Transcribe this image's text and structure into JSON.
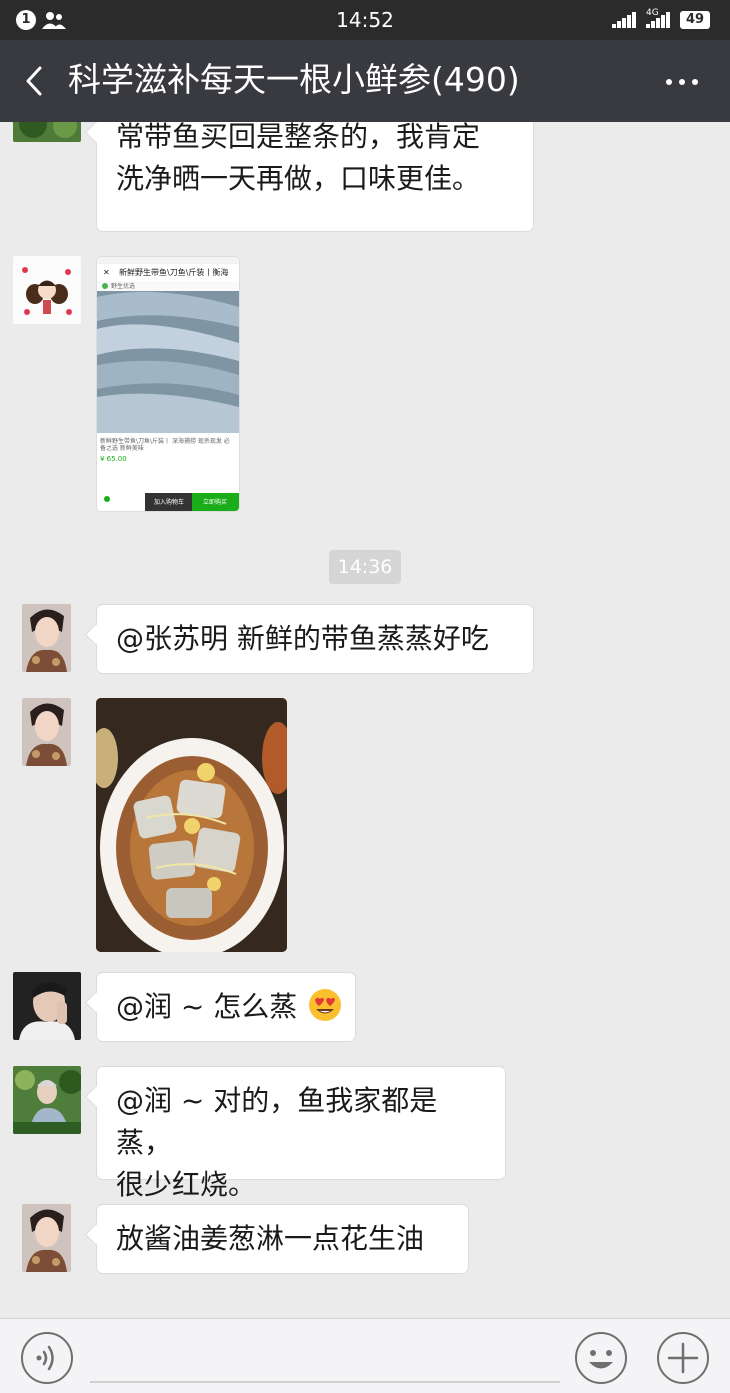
{
  "status_bar": {
    "badge": "1",
    "time": "14:52",
    "network": "4G",
    "battery": "49"
  },
  "header": {
    "title": "科学滋补每天一根小鲜参(490)"
  },
  "messages": [
    {
      "type": "text",
      "lines": [
        "常带鱼买回是整条的，我肯定",
        "洗净晒一天再做，口味更佳。"
      ]
    },
    {
      "type": "image",
      "content": {
        "title": "新鲜野生带鱼\\刀鱼\\斤装丨衡海",
        "shop": "野生优选",
        "desc1": "新鲜野生带鱼\\刀鱼\\斤装丨 深海捕捞 现杀现发 必",
        "desc2": "备之选 新鲜美味",
        "price": "¥ 65.00",
        "btn_cart": "加入购物车",
        "btn_buy": "立即购买"
      }
    },
    {
      "type": "divider",
      "time": "14:36"
    },
    {
      "type": "text",
      "lines": [
        "@张苏明  新鲜的带鱼蒸蒸好吃"
      ]
    },
    {
      "type": "image"
    },
    {
      "type": "text",
      "lines": [
        "@润 ~  怎么蒸"
      ]
    },
    {
      "type": "text",
      "lines": [
        "@润 ~  对的，鱼我家都是蒸，",
        "很少红烧。"
      ]
    },
    {
      "type": "text",
      "lines": [
        "放酱油姜葱淋一点花生油"
      ]
    }
  ],
  "icons": {
    "back": "chevron-left",
    "more": "ellipsis",
    "voice": "voice-mode",
    "emoji": "emoji-face",
    "add": "plus"
  },
  "colors": {
    "title_bar": "#393a3f",
    "status_bar": "#2b2b2b",
    "chat_bg": "#ebebeb",
    "bubble": "#ffffff",
    "wechat_green": "#1aad19"
  }
}
